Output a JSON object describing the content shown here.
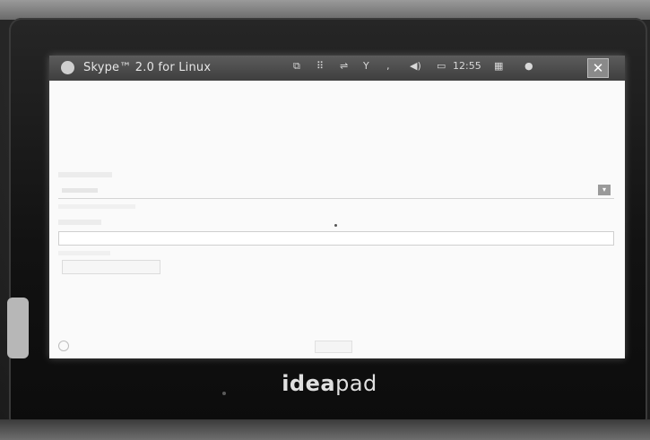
{
  "window": {
    "title": "Skype™ 2.0 for Linux",
    "clock": "12:55",
    "close_glyph": "✕"
  },
  "device": {
    "brand_bold": "idea",
    "brand_regular": "pad"
  },
  "tray_icons": [
    "windows-icon",
    "grid-icon",
    "network-icon",
    "antenna-icon",
    "volume-icon",
    "battery-icon",
    "keyboard-icon",
    "skype-status-icon"
  ]
}
